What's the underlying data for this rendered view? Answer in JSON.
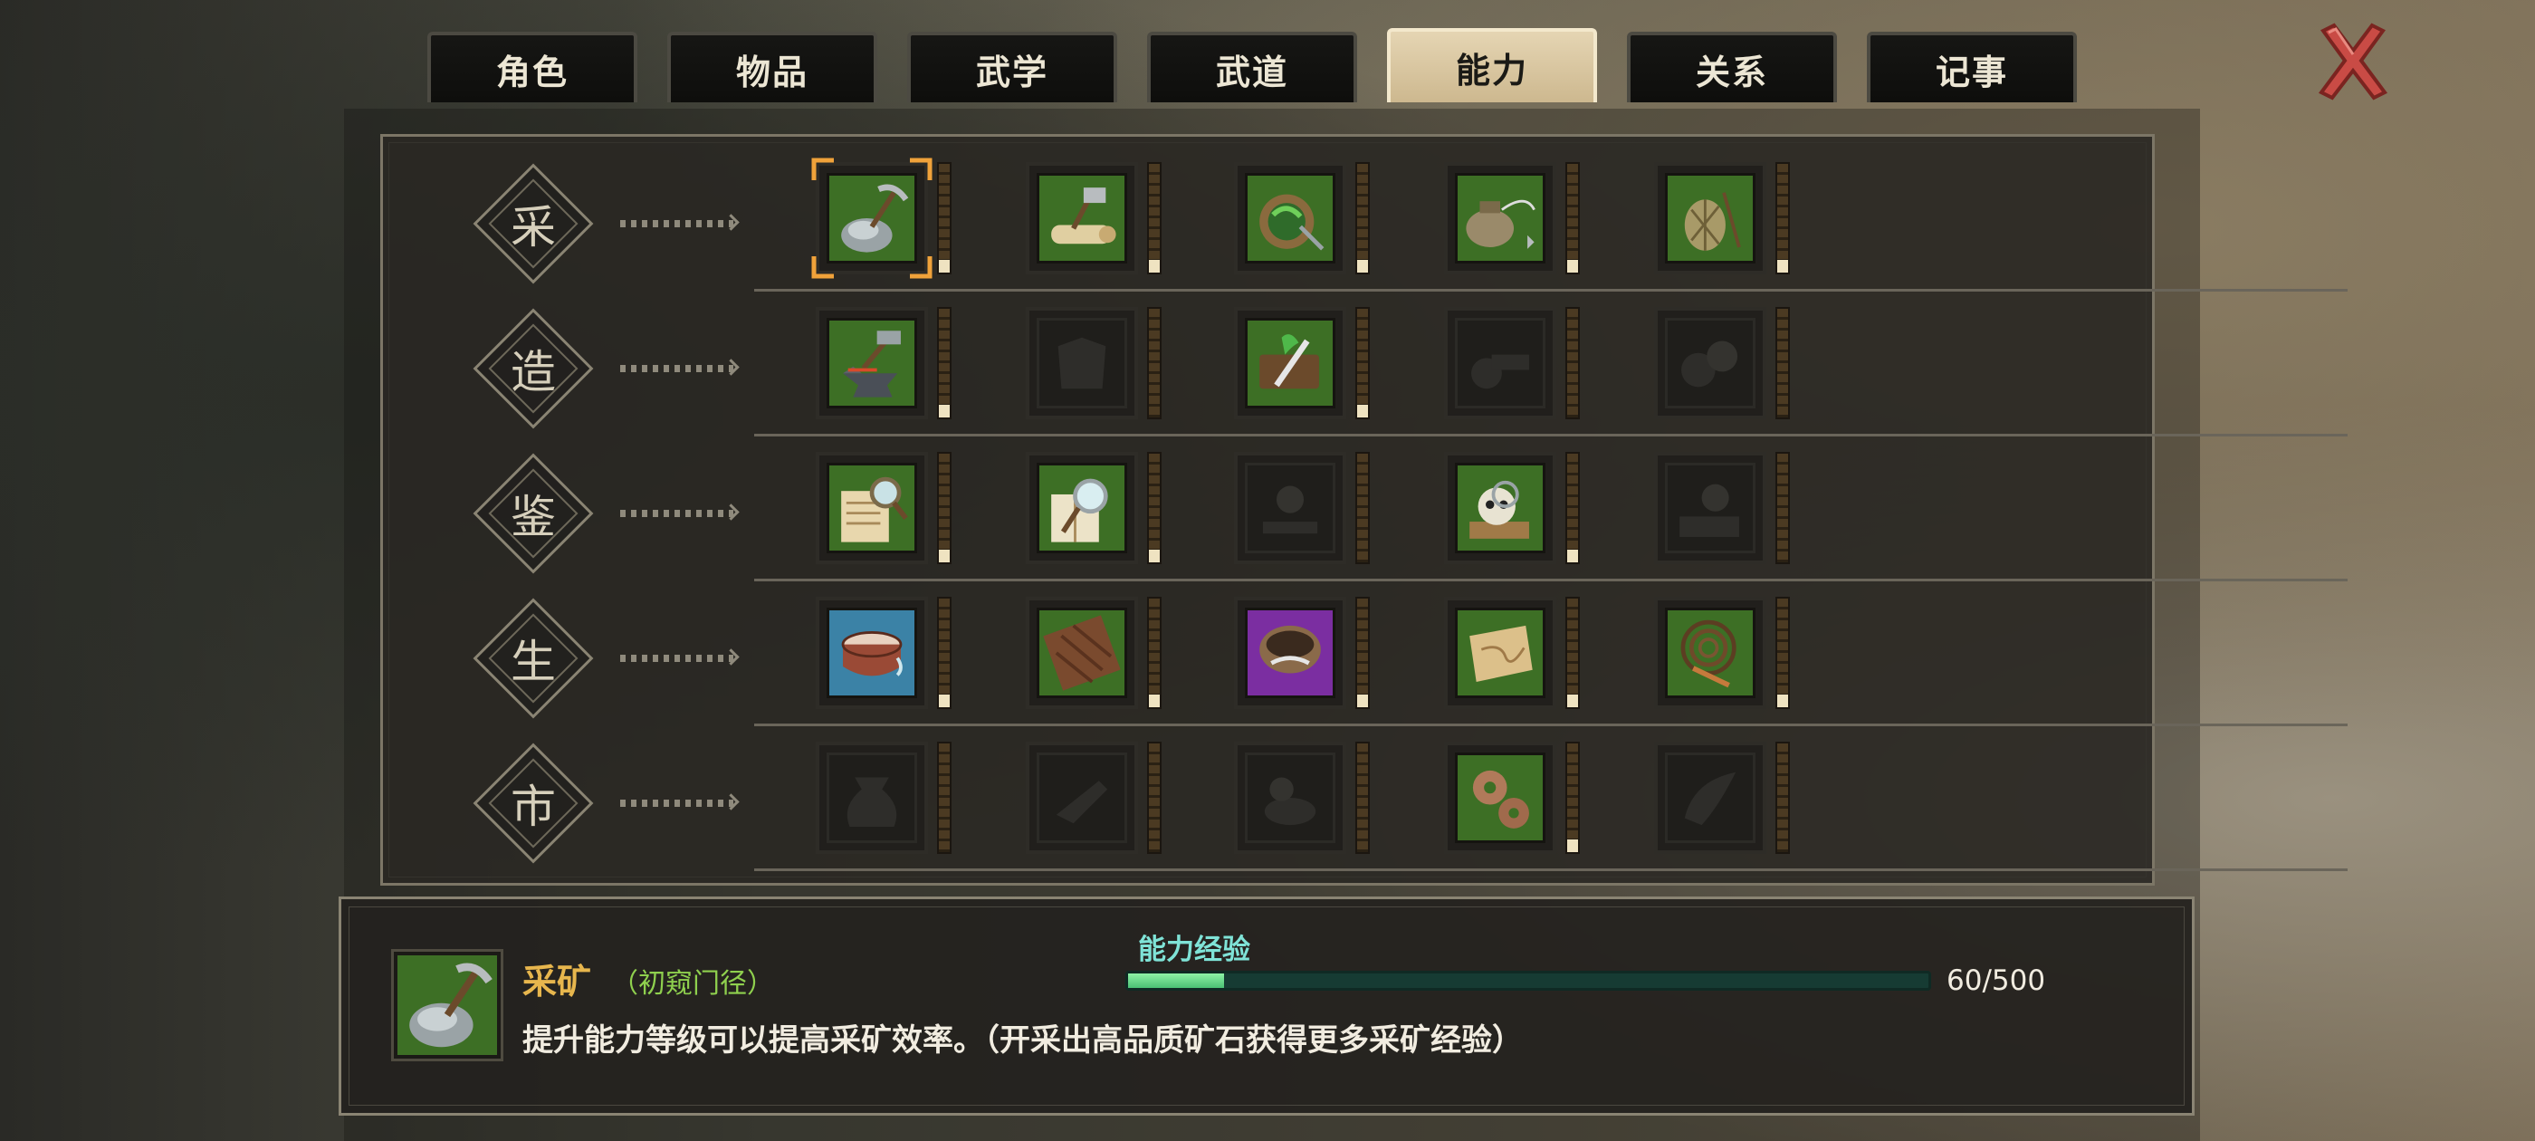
{
  "tabs": [
    {
      "label": "角色",
      "active": false
    },
    {
      "label": "物品",
      "active": false
    },
    {
      "label": "武学",
      "active": false
    },
    {
      "label": "武道",
      "active": false
    },
    {
      "label": "能力",
      "active": true
    },
    {
      "label": "关系",
      "active": false
    },
    {
      "label": "记事",
      "active": false
    }
  ],
  "close_icon": "close-x-icon",
  "categories": [
    {
      "label": "采",
      "skills": [
        {
          "icon": "pickaxe-ore-icon",
          "bg": "green",
          "level": 0.12,
          "selected": true
        },
        {
          "icon": "axe-log-icon",
          "bg": "green",
          "level": 0.12
        },
        {
          "icon": "herb-basket-icon",
          "bg": "green",
          "level": 0.12
        },
        {
          "icon": "fishing-pot-icon",
          "bg": "green",
          "level": 0.12
        },
        {
          "icon": "net-trap-icon",
          "bg": "green",
          "level": 0.12
        }
      ]
    },
    {
      "label": "造",
      "skills": [
        {
          "icon": "anvil-hammer-icon",
          "bg": "green",
          "level": 0.12
        },
        {
          "icon": "armor-icon",
          "bg": "locked",
          "level": 0
        },
        {
          "icon": "herb-knife-icon",
          "bg": "green",
          "level": 0.12
        },
        {
          "icon": "cannon-icon",
          "bg": "locked",
          "level": 0
        },
        {
          "icon": "stones-icon",
          "bg": "locked",
          "level": 0
        }
      ]
    },
    {
      "label": "鉴",
      "skills": [
        {
          "icon": "scroll-magnifier-icon",
          "bg": "green",
          "level": 0.12
        },
        {
          "icon": "book-magnifier-icon",
          "bg": "green",
          "level": 0.12
        },
        {
          "icon": "stand-magnifier-icon",
          "bg": "locked",
          "level": 0
        },
        {
          "icon": "skull-magnifier-icon",
          "bg": "green",
          "level": 0.12
        },
        {
          "icon": "gem-magnifier-icon",
          "bg": "locked",
          "level": 0
        }
      ]
    },
    {
      "label": "生",
      "skills": [
        {
          "icon": "drum-icon",
          "bg": "blue",
          "level": 0.12
        },
        {
          "icon": "chocolate-board-icon",
          "bg": "green",
          "level": 0.12
        },
        {
          "icon": "bowl-icon",
          "bg": "purple",
          "level": 0.12
        },
        {
          "icon": "map-scroll-icon",
          "bg": "green",
          "level": 0.12
        },
        {
          "icon": "whip-icon",
          "bg": "green",
          "level": 0.12
        }
      ]
    },
    {
      "label": "市",
      "skills": [
        {
          "icon": "money-bag-icon",
          "bg": "locked",
          "level": 0
        },
        {
          "icon": "pointing-hand-icon",
          "bg": "locked",
          "level": 0
        },
        {
          "icon": "mortar-icon",
          "bg": "locked",
          "level": 0
        },
        {
          "icon": "gears-icon",
          "bg": "green",
          "level": 0.12
        },
        {
          "icon": "horn-icon",
          "bg": "locked",
          "level": 0
        }
      ]
    }
  ],
  "detail": {
    "icon": "pickaxe-ore-icon",
    "name": "采矿",
    "level_text": "（初窥门径）",
    "description": "提升能力等级可以提高采矿效率。（开采出高品质矿石获得更多采矿经验）",
    "exp_label": "能力经验",
    "exp_current": 60,
    "exp_max": 500,
    "exp_text": "60/500"
  },
  "colors": {
    "accent_gold": "#e7b64d",
    "level_green": "#8fd04e",
    "exp_cyan": "#7fe3d7",
    "tab_active": "#dcc9a4",
    "close_red": "#c94b45"
  }
}
